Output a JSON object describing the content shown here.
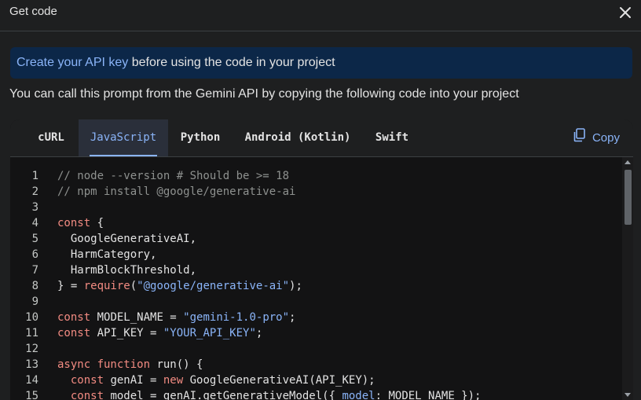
{
  "dialog": {
    "title": "Get code",
    "banner_link": "Create your API key",
    "banner_text": " before using the code in your project",
    "description": "You can call this prompt from the Gemini API by copying the following code into your project",
    "copy_label": "Copy"
  },
  "tabs": [
    {
      "label": "cURL",
      "active": false
    },
    {
      "label": "JavaScript",
      "active": true
    },
    {
      "label": "Python",
      "active": false
    },
    {
      "label": "Android (Kotlin)",
      "active": false
    },
    {
      "label": "Swift",
      "active": false
    }
  ],
  "code_lines": [
    {
      "n": "1",
      "segs": [
        [
          "c-comment",
          "// node --version # Should be >= 18"
        ]
      ]
    },
    {
      "n": "2",
      "segs": [
        [
          "c-comment",
          "// npm install @google/generative-ai"
        ]
      ]
    },
    {
      "n": "3",
      "segs": []
    },
    {
      "n": "4",
      "segs": [
        [
          "c-kw",
          "const"
        ],
        [
          "",
          " {"
        ]
      ]
    },
    {
      "n": "5",
      "segs": [
        [
          "",
          "  GoogleGenerativeAI,"
        ]
      ]
    },
    {
      "n": "6",
      "segs": [
        [
          "",
          "  HarmCategory,"
        ]
      ]
    },
    {
      "n": "7",
      "segs": [
        [
          "",
          "  HarmBlockThreshold,"
        ]
      ]
    },
    {
      "n": "8",
      "segs": [
        [
          "",
          "} = "
        ],
        [
          "c-kw",
          "require"
        ],
        [
          "",
          "("
        ],
        [
          "c-str",
          "\"@google/generative-ai\""
        ],
        [
          "",
          ");"
        ]
      ]
    },
    {
      "n": "9",
      "segs": []
    },
    {
      "n": "10",
      "segs": [
        [
          "c-kw",
          "const"
        ],
        [
          "",
          " MODEL_NAME = "
        ],
        [
          "c-str",
          "\"gemini-1.0-pro\""
        ],
        [
          "",
          ";"
        ]
      ]
    },
    {
      "n": "11",
      "segs": [
        [
          "c-kw",
          "const"
        ],
        [
          "",
          " API_KEY = "
        ],
        [
          "c-str",
          "\"YOUR_API_KEY\""
        ],
        [
          "",
          ";"
        ]
      ]
    },
    {
      "n": "12",
      "segs": []
    },
    {
      "n": "13",
      "segs": [
        [
          "c-kw",
          "async function"
        ],
        [
          "",
          " run() {"
        ]
      ]
    },
    {
      "n": "14",
      "segs": [
        [
          "",
          "  "
        ],
        [
          "c-kw",
          "const"
        ],
        [
          "",
          " genAI = "
        ],
        [
          "c-kw",
          "new"
        ],
        [
          "",
          " GoogleGenerativeAI(API_KEY);"
        ]
      ]
    },
    {
      "n": "15",
      "segs": [
        [
          "",
          "  "
        ],
        [
          "c-kw",
          "const"
        ],
        [
          "",
          " model = genAI.getGenerativeModel({ "
        ],
        [
          "c-str",
          "model"
        ],
        [
          "",
          ": MODEL_NAME });"
        ]
      ]
    }
  ],
  "colors": {
    "background": "#1e1f20",
    "banner": "#0c2748",
    "accent": "#8ab4f8",
    "keyword": "#f28b82",
    "comment": "#8e918f"
  },
  "icons": {
    "close": "close-icon",
    "copy": "copy-icon"
  }
}
